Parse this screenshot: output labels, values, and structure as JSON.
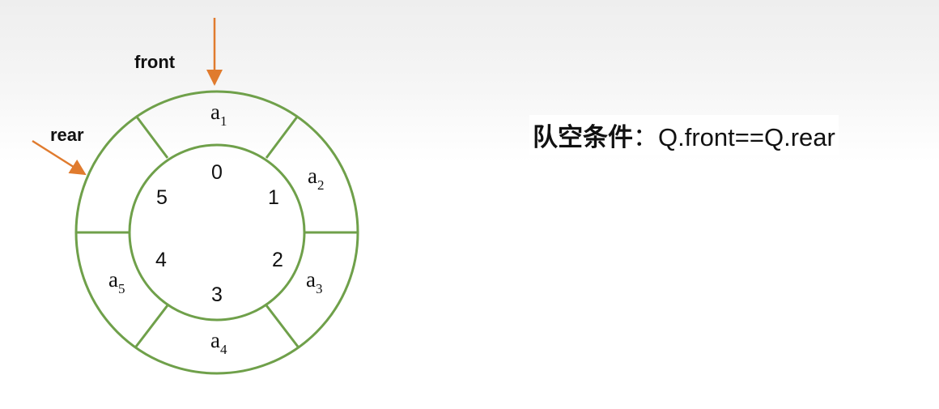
{
  "pointers": {
    "front": "front",
    "rear": "rear"
  },
  "ring": {
    "indices": [
      "0",
      "1",
      "2",
      "3",
      "4",
      "5"
    ],
    "elements": [
      {
        "slot": "a1",
        "base": "a",
        "sub": "1"
      },
      {
        "slot": "a2",
        "base": "a",
        "sub": "2"
      },
      {
        "slot": "a3",
        "base": "a",
        "sub": "3"
      },
      {
        "slot": "a4",
        "base": "a",
        "sub": "4"
      },
      {
        "slot": "a5",
        "base": "a",
        "sub": "5"
      }
    ]
  },
  "condition": {
    "label": "队空条件",
    "separator": "：",
    "expression": "Q.front==Q.rear"
  },
  "colors": {
    "ring": "#6fa04a",
    "arrow": "#e07b2e",
    "text": "#111111"
  }
}
